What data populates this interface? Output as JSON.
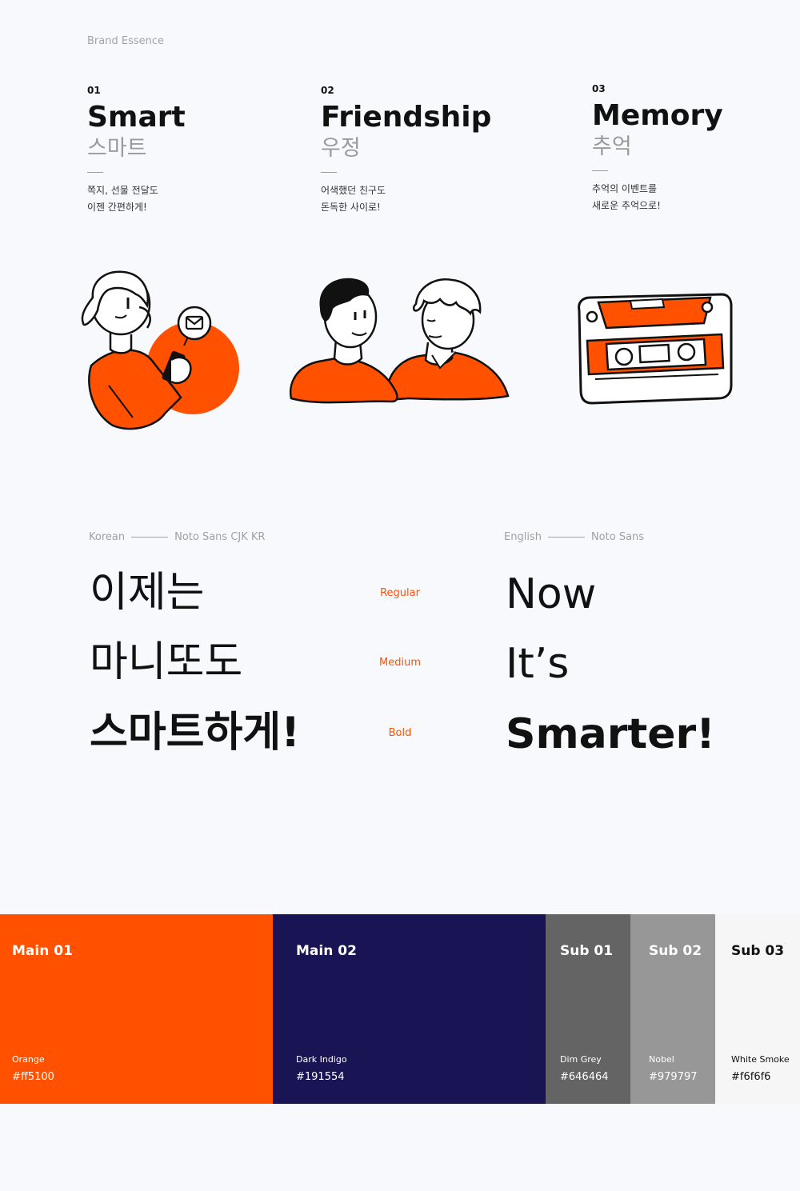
{
  "section_label": "Brand Essence",
  "essence": [
    {
      "num": "01",
      "en": "Smart",
      "ko": "스마트",
      "desc": "쪽지, 선물 전달도\n이젠 간편하게!"
    },
    {
      "num": "02",
      "en": "Friendship",
      "ko": "우정",
      "desc": "어색했던 친구도\n돈독한 사이로!"
    },
    {
      "num": "03",
      "en": "Memory",
      "ko": "추억",
      "desc": "추억의 이벤트를\n새로운 추억으로!"
    }
  ],
  "typography": {
    "korean": {
      "label": "Korean",
      "font": "Noto Sans CJK KR",
      "samples": [
        "이제는",
        "마니또도",
        "스마트하게!"
      ]
    },
    "english": {
      "label": "English",
      "font": "Noto Sans",
      "samples": [
        "Now",
        "It’s",
        "Smarter!"
      ]
    },
    "weights": [
      "Regular",
      "Medium",
      "Bold"
    ]
  },
  "palette": [
    {
      "title": "Main 01",
      "name": "Orange",
      "hex": "#ff5100",
      "text_color": "#ffffff"
    },
    {
      "title": "Main 02",
      "name": "Dark Indigo",
      "hex": "#191554",
      "text_color": "#ffffff"
    },
    {
      "title": "Sub 01",
      "name": "Dim Grey",
      "hex": "#646464",
      "text_color": "#ffffff"
    },
    {
      "title": "Sub 02",
      "name": "Nobel",
      "hex": "#979797",
      "text_color": "#ffffff"
    },
    {
      "title": "Sub 03",
      "name": "White Smoke",
      "hex": "#f6f6f6",
      "text_color": "#111111"
    }
  ],
  "colors": {
    "accent": "#ff5100",
    "ink": "#111111",
    "background": "#f8f9fd"
  },
  "icons": [
    "woman-with-phone-illustration",
    "mail-icon",
    "two-friends-illustration",
    "cassette-tape-illustration"
  ]
}
